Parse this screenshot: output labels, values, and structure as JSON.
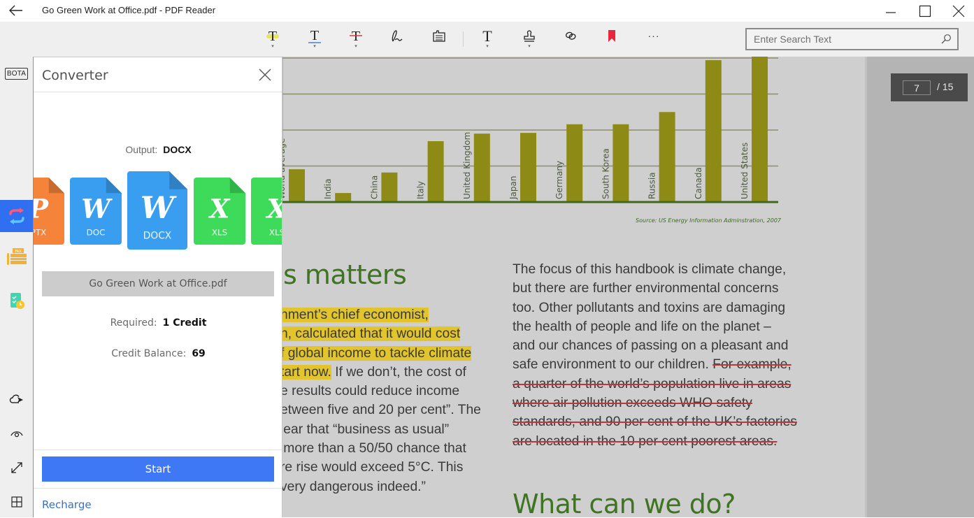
{
  "window": {
    "title": "Go Green Work at Office.pdf - PDF Reader",
    "controls": {
      "minimize": "minimize",
      "maximize": "maximize",
      "close": "close"
    }
  },
  "toolbar": {
    "tools": [
      {
        "id": "highlight",
        "icon": "highlight-text-icon",
        "has_dropdown": true,
        "accent": "#e8e04a"
      },
      {
        "id": "underline",
        "icon": "underline-text-icon",
        "has_dropdown": true,
        "accent": "#4a7fd4"
      },
      {
        "id": "strikethrough",
        "icon": "strikethrough-text-icon",
        "has_dropdown": true,
        "accent": "#d03a3a"
      },
      {
        "id": "freehand",
        "icon": "pen-signature-icon",
        "has_dropdown": false
      },
      {
        "id": "note",
        "icon": "note-icon",
        "has_dropdown": false
      },
      {
        "id": "textbox",
        "icon": "text-box-icon",
        "has_dropdown": true
      },
      {
        "id": "stamp",
        "icon": "stamp-icon",
        "has_dropdown": true
      },
      {
        "id": "link",
        "icon": "link-icon",
        "has_dropdown": false
      },
      {
        "id": "bookmark",
        "icon": "bookmark-icon",
        "has_dropdown": false,
        "accent": "#e8283a"
      },
      {
        "id": "more",
        "icon": "more-icon",
        "label": "···",
        "has_dropdown": false
      }
    ],
    "caret": "▾",
    "search": {
      "placeholder": "Enter Search Text",
      "value": ""
    }
  },
  "rail": {
    "top_items": [
      {
        "id": "bota",
        "label": "BOTA"
      },
      {
        "id": "converter",
        "icon": "convert-icon",
        "active": true
      },
      {
        "id": "fax",
        "icon": "fax-icon",
        "badge": "FAX"
      },
      {
        "id": "tasks",
        "icon": "checklist-clock-icon"
      }
    ],
    "bottom_items": [
      {
        "id": "cloud",
        "icon": "cloud-icon"
      },
      {
        "id": "view",
        "icon": "eye-icon"
      },
      {
        "id": "fullscreen",
        "icon": "expand-icon"
      },
      {
        "id": "thumbnails",
        "icon": "grid-icon"
      }
    ]
  },
  "converter": {
    "title": "Converter",
    "output_label": "Output:",
    "output_value": "DOCX",
    "formats": [
      {
        "label": "PPTX",
        "shown": "PTX",
        "letter": "P",
        "color": "#f5833a"
      },
      {
        "label": "DOC",
        "letter": "W",
        "color": "#3a9ef0"
      },
      {
        "label": "DOCX",
        "letter": "W",
        "color": "#3a9ef0",
        "selected": true
      },
      {
        "label": "XLS",
        "letter": "X",
        "color": "#3edb5a"
      },
      {
        "label": "XLS",
        "letter": "X",
        "color": "#3edb5a"
      }
    ],
    "file_name": "Go Green Work at Office.pdf",
    "required_label": "Required:",
    "required_value": "1 Credit",
    "balance_label": "Credit Balance:",
    "balance_value": "69",
    "start_label": "Start",
    "recharge_label": "Recharge",
    "accent": "#3e78f5"
  },
  "document": {
    "page_current": "7",
    "page_total": "/ 15",
    "chart_source": "Source: US Energy Information Adminstration, 2007",
    "heading_1": "is matters",
    "heading_2": "What can we do?",
    "left_paragraph": [
      {
        "segments": [
          {
            "text": "nment’s chief economist,",
            "style": "highlight"
          }
        ]
      },
      {
        "segments": [
          {
            "text": "n, calculated that it would cost ",
            "style": "highlight"
          }
        ]
      },
      {
        "segments": [
          {
            "text": "f global income to tackle climate",
            "style": "highlight"
          }
        ]
      },
      {
        "segments": [
          {
            "text": "tart now.",
            "style": "highlight"
          },
          {
            "text": " If we don’t, the cost of",
            "style": "normal"
          }
        ]
      },
      {
        "segments": [
          {
            "text": "e results could reduce income",
            "style": "normal"
          }
        ]
      },
      {
        "segments": [
          {
            "text": "etween five and 20 per cent”. The",
            "style": "normal"
          }
        ]
      },
      {
        "segments": [
          {
            "text": "lear that “business as usual”",
            "style": "normal"
          }
        ]
      },
      {
        "segments": [
          {
            "text": "‘more than a 50/50 chance that",
            "style": "normal"
          }
        ]
      },
      {
        "segments": [
          {
            "text": "re rise would exceed 5°C. This",
            "style": "normal"
          }
        ]
      },
      {
        "segments": [
          {
            "text": "very dangerous indeed.”",
            "style": "normal"
          }
        ]
      }
    ],
    "right_paragraph": [
      {
        "segments": [
          {
            "text": "The focus of this handbook is climate change,",
            "style": "normal"
          }
        ]
      },
      {
        "segments": [
          {
            "text": "but there are further environmental concerns",
            "style": "normal"
          }
        ]
      },
      {
        "segments": [
          {
            "text": "too. Other pollutants and toxins are damaging",
            "style": "normal"
          }
        ]
      },
      {
        "segments": [
          {
            "text": "the health of people and life on the planet –",
            "style": "normal"
          }
        ]
      },
      {
        "segments": [
          {
            "text": "and our chances of passing on a pleasant and",
            "style": "normal"
          }
        ]
      },
      {
        "segments": [
          {
            "text": "safe environment to our children. ",
            "style": "normal"
          },
          {
            "text": "For example, ",
            "style": "strike"
          }
        ]
      },
      {
        "segments": [
          {
            "text": "a quarter of the world’s population live in areas ",
            "style": "strike"
          }
        ]
      },
      {
        "segments": [
          {
            "text": "where air pollution exceeds WHO safety",
            "style": "strike"
          }
        ]
      },
      {
        "segments": [
          {
            "text": "standards, and 90 per cent of the UK’s factories ",
            "style": "strike"
          }
        ]
      },
      {
        "segments": [
          {
            "text": "are located in the 10 per cent poorest areas.",
            "style": "strike"
          }
        ]
      }
    ],
    "colors": {
      "highlight": "#e2c52c",
      "strike": "#c0353a",
      "heading": "#3f7423",
      "bar": "#8d8a16",
      "axis": "#3f6a1e"
    }
  },
  "chart_data": {
    "type": "bar",
    "title": "",
    "xlabel": "",
    "ylabel": "",
    "units": "relative gridline steps (no numeric axis labels visible)",
    "categories": [
      "World average",
      "India",
      "China",
      "Italy",
      "United Kingdom",
      "Japan",
      "Germany",
      "South Korea",
      "Russia",
      "Canada",
      "United States"
    ],
    "values": [
      0.91,
      0.25,
      0.82,
      1.69,
      1.9,
      1.92,
      2.16,
      2.16,
      2.5,
      3.94,
      4.2
    ],
    "ylim": [
      0,
      4
    ],
    "grid": true,
    "source": "Source: US Energy Information Adminstration, 2007",
    "note": "Chart top is clipped by the viewport; United States bar exceeds the visible range."
  }
}
